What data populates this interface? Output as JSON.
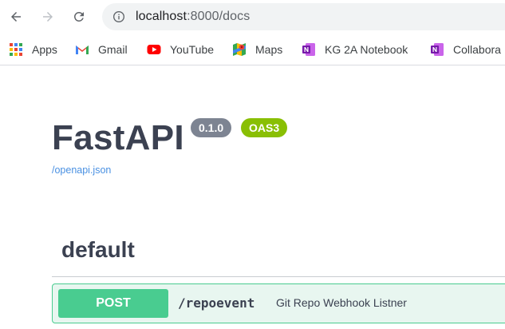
{
  "browser": {
    "url_host": "localhost",
    "url_rest": ":8000/docs"
  },
  "bookmarks": [
    {
      "label": "Apps",
      "icon": "apps-grid-icon"
    },
    {
      "label": "Gmail",
      "icon": "gmail-icon"
    },
    {
      "label": "YouTube",
      "icon": "youtube-icon"
    },
    {
      "label": "Maps",
      "icon": "maps-icon"
    },
    {
      "label": "KG 2A Notebook",
      "icon": "onenote-icon"
    },
    {
      "label": "Collabora",
      "icon": "onenote-icon"
    }
  ],
  "page": {
    "title": "FastAPI",
    "version_badge": "0.1.0",
    "oas_badge": "OAS3",
    "spec_link": "/openapi.json",
    "section_title": "default",
    "operations": [
      {
        "method": "POST",
        "path": "/repoevent",
        "summary": "Git Repo Webhook Listner"
      }
    ]
  },
  "colors": {
    "post_green": "#49cc90",
    "post_bg": "#e8f6f0",
    "version_badge": "#7d8492",
    "oas_badge": "#89bf04",
    "link": "#4990e2"
  }
}
